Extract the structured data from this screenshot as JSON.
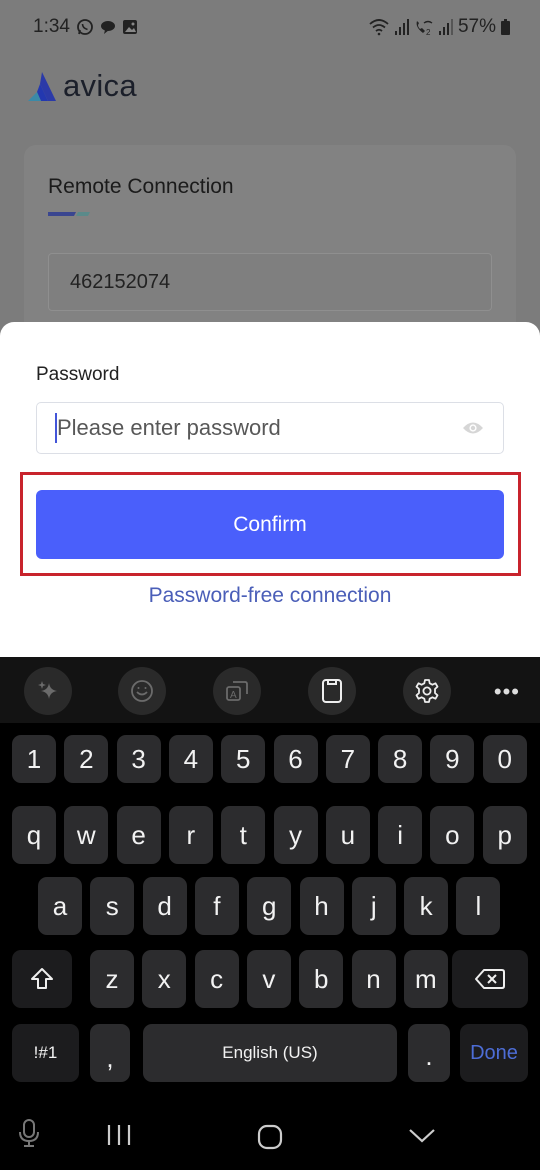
{
  "status_bar": {
    "time": "1:34",
    "left_icons": [
      "whatsapp-icon",
      "chat-bubble-icon",
      "gallery-icon"
    ],
    "right_icons": [
      "wifi-icon",
      "signal-icon",
      "wifi-calling-icon",
      "signal-icon"
    ],
    "battery": "57%"
  },
  "app": {
    "logo_text": "avica",
    "card_title": "Remote Connection",
    "device_id": "462152074",
    "colors": {
      "brand_blue": "#4a5ffb",
      "link": "#4a5eb8",
      "highlight": "#c8232c"
    }
  },
  "sheet": {
    "password_label": "Password",
    "password_placeholder": "Please enter password",
    "password_value": "",
    "confirm_label": "Confirm",
    "password_free_label": "Password-free connection"
  },
  "keyboard": {
    "toolbar": [
      "ai-sparkle-icon",
      "emoji-icon",
      "translate-icon",
      "clipboard-icon",
      "settings-icon",
      "more-icon"
    ],
    "rows": [
      [
        "1",
        "2",
        "3",
        "4",
        "5",
        "6",
        "7",
        "8",
        "9",
        "0"
      ],
      [
        "q",
        "w",
        "e",
        "r",
        "t",
        "y",
        "u",
        "i",
        "o",
        "p"
      ],
      [
        "a",
        "s",
        "d",
        "f",
        "g",
        "h",
        "j",
        "k",
        "l"
      ],
      [
        "z",
        "x",
        "c",
        "v",
        "b",
        "n",
        "m"
      ]
    ],
    "symbols_label": "!#1",
    "comma": ",",
    "space_label": "English (US)",
    "period": ".",
    "done_label": "Done"
  }
}
